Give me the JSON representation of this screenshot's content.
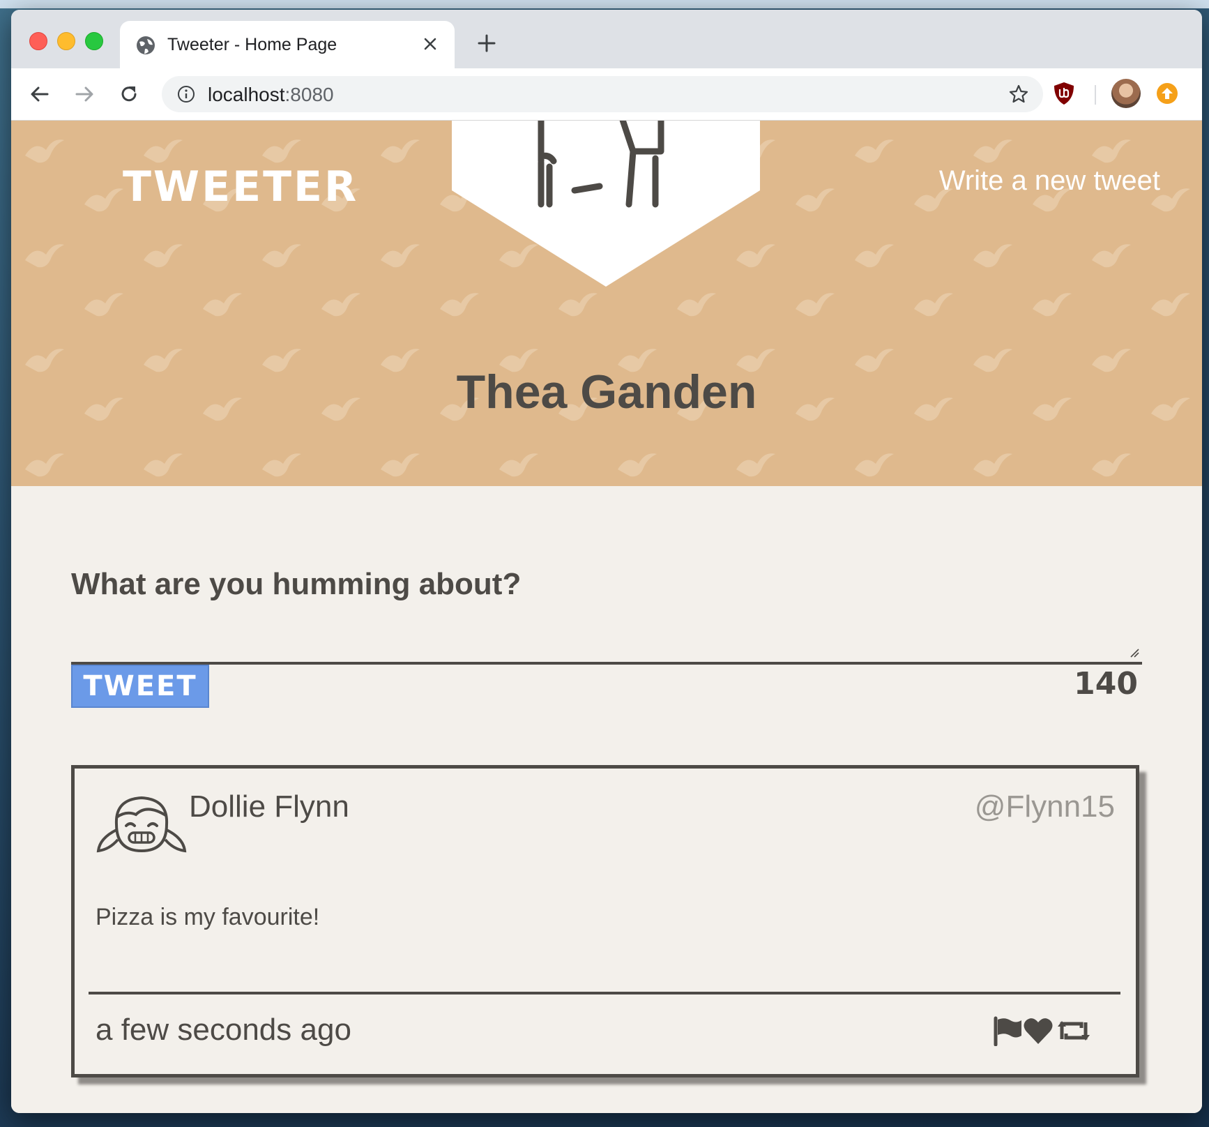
{
  "browser": {
    "tab_title": "Tweeter - Home Page",
    "url_host": "localhost",
    "url_port": ":8080",
    "icons": [
      "globe-icon",
      "close-icon",
      "plus-icon",
      "back-icon",
      "forward-icon",
      "reload-icon",
      "info-icon",
      "star-icon",
      "ublock-icon",
      "avatar",
      "update-icon"
    ]
  },
  "header": {
    "logo": "TWEETER",
    "write_link": "Write a new tweet",
    "profile_name": "Thea Ganden",
    "background_color": "#dfb98d"
  },
  "compose": {
    "title": "What are you humming about?",
    "input_value": "",
    "button_label": "TWEET",
    "button_color": "#6b9ae8",
    "counter": "140"
  },
  "tweets": [
    {
      "name": "Dollie Flynn",
      "handle": "@Flynn15",
      "content": "Pizza is my favourite!",
      "time": "a few seconds ago",
      "actions": [
        "flag-icon",
        "heart-icon",
        "retweet-icon"
      ]
    }
  ]
}
